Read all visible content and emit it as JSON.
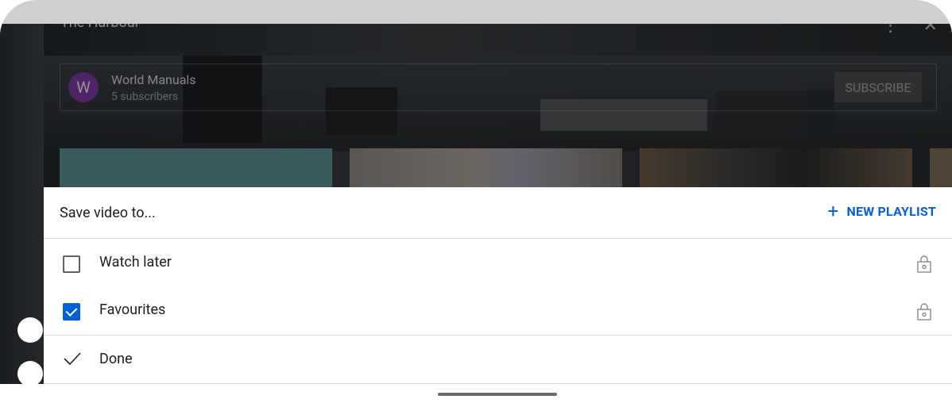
{
  "video": {
    "title": "The Harbour"
  },
  "channel": {
    "avatar_letter": "W",
    "name": "World Manuals",
    "subscribers": "5 subscribers",
    "subscribe_label": "SUBSCRIBE"
  },
  "sheet": {
    "title": "Save video to...",
    "new_playlist_label": "NEW PLAYLIST",
    "playlists": [
      {
        "label": "Watch later",
        "checked": false,
        "private": true
      },
      {
        "label": "Favourites",
        "checked": true,
        "private": true
      }
    ],
    "done_label": "Done"
  },
  "colors": {
    "accent": "#065fd4",
    "sheet_background": "#ffffff"
  },
  "icons": [
    "more-vert-icon",
    "close-icon",
    "plus-icon",
    "lock-icon",
    "check-icon"
  ]
}
